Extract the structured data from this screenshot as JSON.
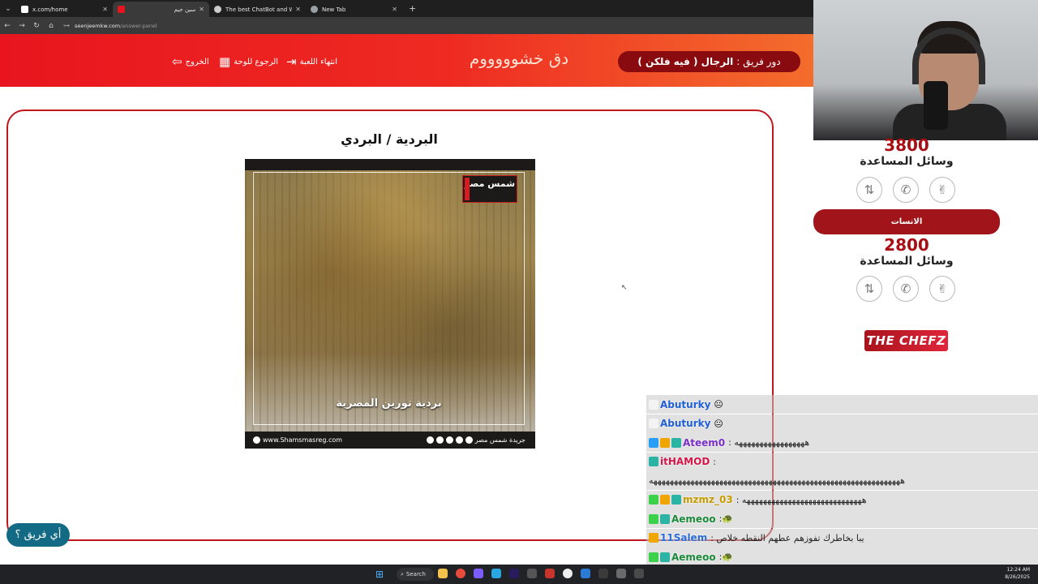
{
  "browser": {
    "menu_glyph": "⌄",
    "tabs": [
      {
        "title": "x.com/home",
        "close": "✕",
        "favicon_color": "#ffffff",
        "active": false
      },
      {
        "title": "سين جيم",
        "close": "✕",
        "favicon_color": "#e8151e",
        "active": true
      },
      {
        "title": "The best ChatBot and Widgets",
        "close": "✕",
        "favicon_color": "#cccccc",
        "active": false
      },
      {
        "title": "New Tab",
        "close": "✕",
        "favicon_color": "#9aa0a6",
        "active": false
      }
    ],
    "new_tab": "+",
    "nav": {
      "back": "←",
      "forward": "→",
      "reload": "↻",
      "home": "⌂"
    },
    "url_tune": "⊶",
    "url_host": "seenjeemkw.com",
    "url_path": "/answer-panel"
  },
  "header": {
    "turn_prefix": "دور فريق :",
    "turn_team": "الرجال ( فيه فلكن )",
    "timer_text": "دق خشوووووم",
    "buttons": {
      "end_game": {
        "label": "انتهاء اللعبة",
        "icon": "⇥"
      },
      "back_to_board": {
        "label": "الرجوع للوحة",
        "icon": "▦"
      },
      "exit": {
        "label": "الخروج",
        "icon": "⇦"
      }
    }
  },
  "question": {
    "answer_title": "البردية / البردي",
    "image": {
      "logo_text": "شمس مصر",
      "caption": "بردية تورين المصرية",
      "footer_site": "www.Shamsmasreg.com",
      "footer_brand": "جريدة شمس مصر"
    }
  },
  "which_team_button": "أي فريق ؟",
  "cursor_glyph": "↖",
  "teams": {
    "team1": {
      "score": "3800",
      "aids_label": "وسائل المساعدة"
    },
    "team2": {
      "name": "الانسات",
      "score": "2800",
      "aids_label": "وسائل المساعدة"
    }
  },
  "aid_icons": {
    "swap": "⇅",
    "call": "✆",
    "peace": "✌"
  },
  "sponsor": "THE CHEFZ",
  "chat": [
    {
      "user": "Abuturky",
      "text": "",
      "emoji": "😐",
      "color": "#1f5fd6",
      "badges": [
        "#f3f3f3"
      ]
    },
    {
      "user": "Abuturky",
      "text": "",
      "emoji": "😐",
      "color": "#1f5fd6",
      "badges": [
        "#f3f3f3"
      ]
    },
    {
      "user": "Ateem0",
      "text": ": هههههههههههههههههه",
      "emoji": "",
      "color": "#7a2ec8",
      "badges": [
        "#2a9df4",
        "#f0a500",
        "#2bb3a4"
      ]
    },
    {
      "user": "itHAMOD",
      "text": ":",
      "emoji": "",
      "color": "#d3174a",
      "badges": [
        "#2bb3a4"
      ]
    },
    {
      "user": "",
      "text": "هههههههههههههههههههههههههههههههههههههههههههههههههههههههههههههه",
      "emoji": "",
      "color": "#222222",
      "badges": []
    },
    {
      "user": "mzmz_03",
      "text": ": هههههههههههههههههههههههههههههه",
      "emoji": "",
      "color": "#c79b00",
      "badges": [
        "#3bd14a",
        "#f0a500",
        "#2bb3a4"
      ]
    },
    {
      "user": "Aemeoo",
      "text": ":",
      "emoji": "🐢",
      "color": "#1b8a3a",
      "badges": [
        "#3bd14a",
        "#2bb3a4"
      ]
    },
    {
      "user": "11Salem",
      "text": ": يبا بخاطرك تفوزهم عطهم النقطه خلاص",
      "emoji": "",
      "color": "#2a6bd6",
      "badges": [
        "#f0a500"
      ]
    },
    {
      "user": "Aemeoo",
      "text": ":",
      "emoji": "🐢",
      "color": "#1b8a3a",
      "badges": [
        "#3bd14a",
        "#2bb3a4"
      ]
    }
  ],
  "taskbar": {
    "start_glyph": "⊞",
    "search_glyph": "⌕",
    "search_label": "Search",
    "time": "12:24 AM",
    "date": "8/26/2025"
  }
}
